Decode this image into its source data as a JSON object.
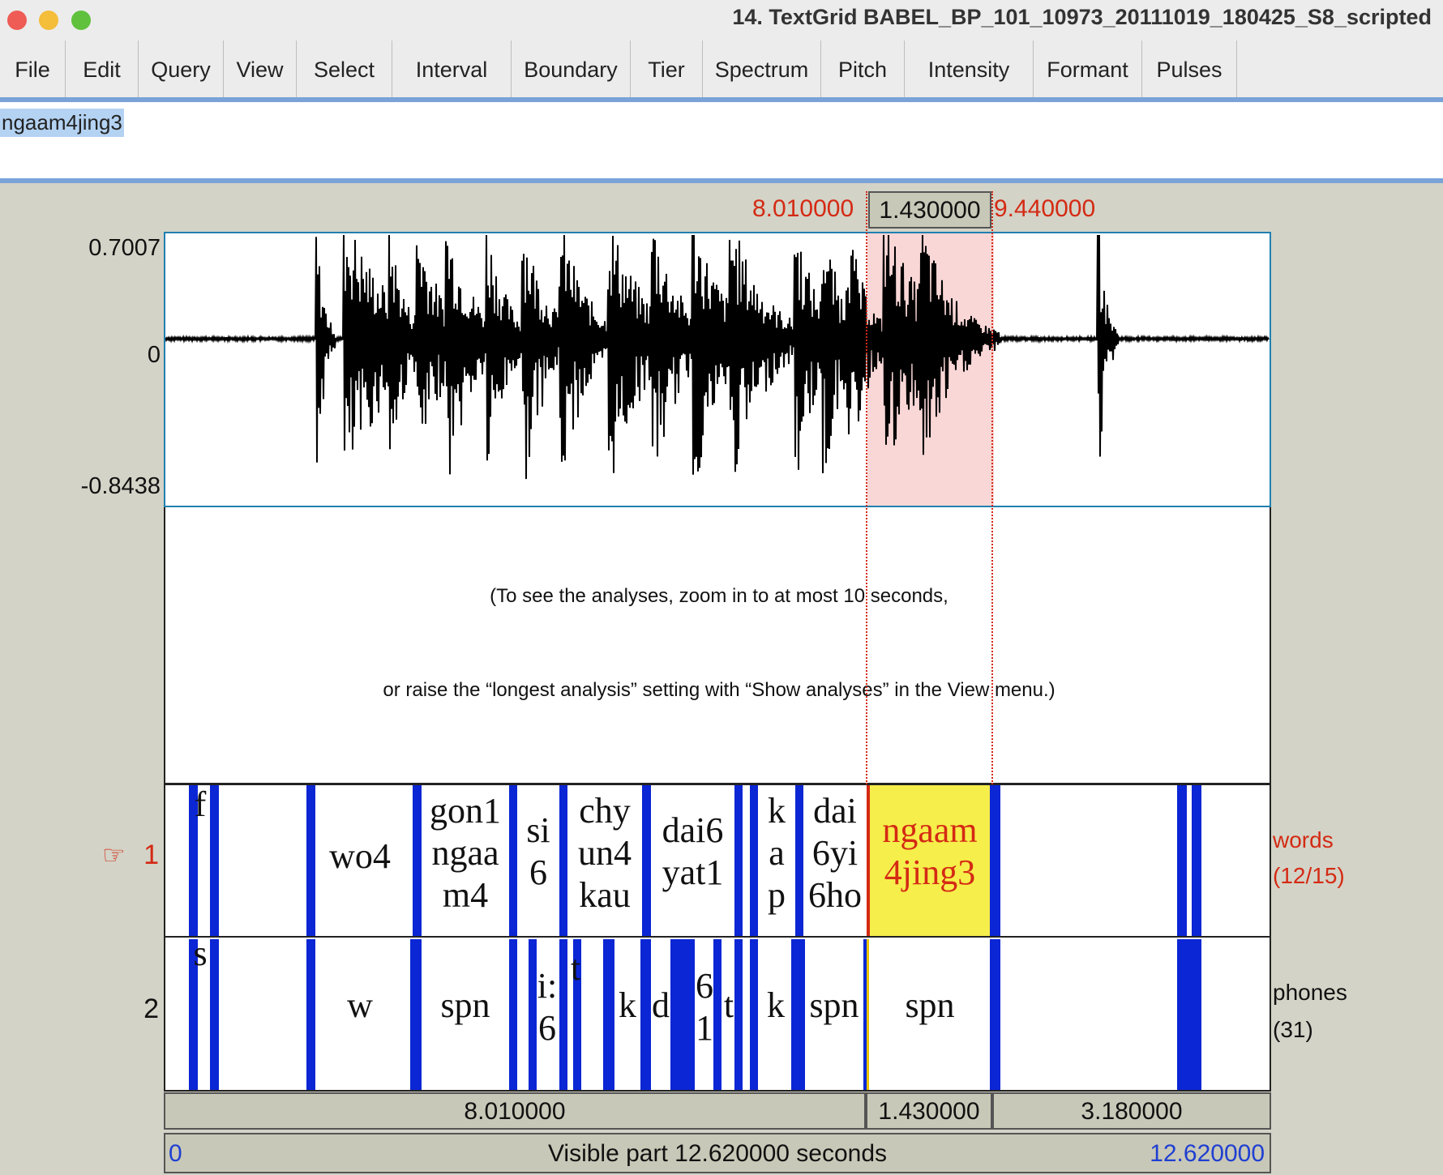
{
  "window": {
    "title": "14. TextGrid BABEL_BP_101_10973_20111019_180425_S8_scripted"
  },
  "menus": [
    "File",
    "Edit",
    "Query",
    "View",
    "Select",
    "Interval",
    "Boundary",
    "Tier",
    "Spectrum",
    "Pitch",
    "Intensity",
    "Formant",
    "Pulses"
  ],
  "text_field": {
    "value": "ngaam4jing3"
  },
  "selection": {
    "start": "8.010000",
    "duration": "1.430000",
    "end": "9.440000"
  },
  "waveform": {
    "ymax": "0.7007",
    "zero": "0",
    "ymin": "-0.8438"
  },
  "analysis_message": {
    "line1": "(To see the analyses, zoom in to at most 10 seconds,",
    "line2": "or raise the “longest analysis” setting with “Show analyses” in the View menu.)"
  },
  "tiers": [
    {
      "number": "1",
      "pointer": "☞",
      "name": "words",
      "count": "(12/15)"
    },
    {
      "number": "2",
      "name": "phones",
      "count": "(31)"
    }
  ],
  "words_labels": [
    "f",
    "wo4",
    "gon1\nngaa\nm4",
    "si\n6",
    "chy\nun4\nkau",
    "dai6\nyat1",
    "k\na\np",
    "dai\n6yi\n6ho",
    "ngaam\n4jing3"
  ],
  "phones_labels": [
    "s",
    "w",
    "spn",
    "i:\n6",
    "t",
    "k",
    "d",
    "6\n1",
    "t",
    "k",
    "spn",
    "spn"
  ],
  "durations": {
    "before": "8.010000",
    "selected": "1.430000",
    "after": "3.180000"
  },
  "visible": {
    "start": "0",
    "label": "Visible part 12.620000 seconds",
    "end": "12.620000"
  },
  "colors": {
    "selection_fill": "#f8d7d6",
    "boundary": "#0b26d4",
    "selected_interval": "#f6ee4a",
    "accent_red": "#d42a14",
    "accent_blue": "#1f3fd1"
  }
}
